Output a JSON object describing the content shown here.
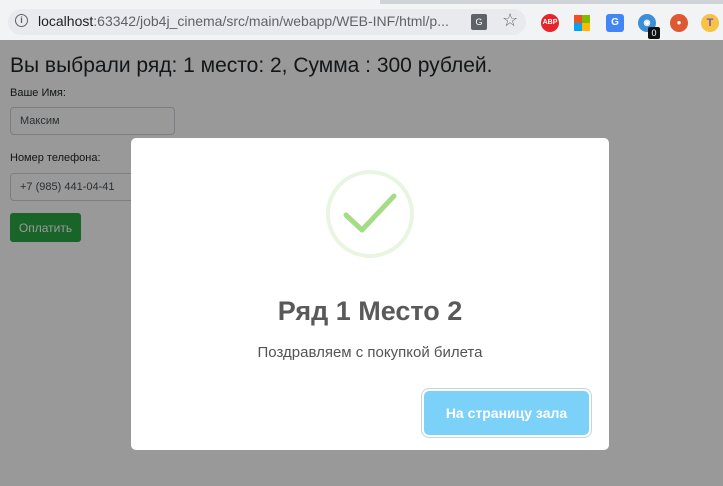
{
  "browser": {
    "url_host": "localhost",
    "url_path": ":63342/job4j_cinema/src/main/webapp/WEB-INF/html/p...",
    "extension_badge": "0",
    "abp_label": "ABP",
    "t_label": "T"
  },
  "page": {
    "heading": "Вы выбрали ряд: 1 место: 2, Сумма : 300 рублей.",
    "name_label": "Ваше Имя:",
    "name_value": "Максим",
    "phone_label": "Номер телефона:",
    "phone_value": "+7 (985) 441-04-41",
    "pay_button": "Оплатить"
  },
  "modal": {
    "icon": "success-check-icon",
    "title": "Ряд 1 Место 2",
    "text": "Поздравляем с покупкой билета",
    "button": "На страницу зала"
  },
  "colors": {
    "pay_button": "#28a745",
    "modal_button": "#7cd1f9",
    "check": "#a5dc86"
  }
}
